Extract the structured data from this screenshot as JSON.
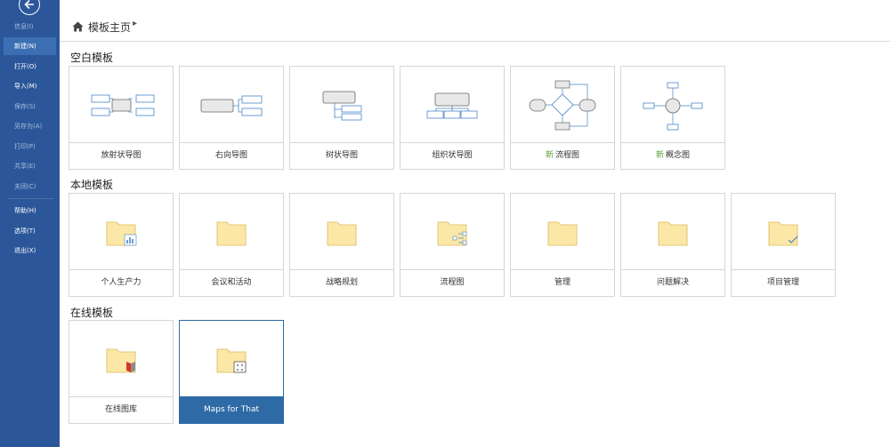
{
  "sidebar": {
    "items": [
      {
        "label": "信息(I)",
        "state": "dim"
      },
      {
        "label": "新建(N)",
        "state": "active"
      },
      {
        "label": "打开(O)",
        "state": "normal"
      },
      {
        "label": "导入(M)",
        "state": "normal"
      },
      {
        "label": "保存(S)",
        "state": "dim"
      },
      {
        "label": "另存为(A)",
        "state": "dim"
      },
      {
        "label": "打印(P)",
        "state": "dim"
      },
      {
        "label": "共享(E)",
        "state": "dim"
      },
      {
        "label": "关闭(C)",
        "state": "dim"
      },
      {
        "label": "帮助(H)",
        "state": "normal"
      },
      {
        "label": "选项(T)",
        "state": "normal"
      },
      {
        "label": "退出(X)",
        "state": "normal"
      }
    ]
  },
  "breadcrumb": {
    "label": "模板主页",
    "chevron": "▸"
  },
  "sections": {
    "blank": {
      "title": "空白模板",
      "items": [
        {
          "label": "放射状导图",
          "thumb": "radial-map"
        },
        {
          "label": "右向导图",
          "thumb": "right-map"
        },
        {
          "label": "树状导图",
          "thumb": "tree-map"
        },
        {
          "label": "组织状导图",
          "thumb": "org-map"
        },
        {
          "label": "流程图",
          "badge": "新",
          "thumb": "flowchart"
        },
        {
          "label": "概念图",
          "badge": "新",
          "thumb": "concept-map"
        }
      ]
    },
    "local": {
      "title": "本地模板",
      "items": [
        {
          "label": "个人生产力",
          "icon": "chart-folder-icon"
        },
        {
          "label": "会议和活动",
          "icon": "folder-icon"
        },
        {
          "label": "战略规划",
          "icon": "folder-icon"
        },
        {
          "label": "流程图",
          "icon": "flow-folder-icon"
        },
        {
          "label": "管理",
          "icon": "folder-icon"
        },
        {
          "label": "问题解决",
          "icon": "folder-icon"
        },
        {
          "label": "项目管理",
          "icon": "check-folder-icon"
        }
      ]
    },
    "online": {
      "title": "在线模板",
      "items": [
        {
          "label": "在线图库",
          "icon": "book-folder-icon"
        },
        {
          "label": "Maps for That",
          "icon": "map-folder-icon",
          "selected": true
        }
      ]
    }
  },
  "colors": {
    "sidebar": "#2b579a",
    "sidebar_active": "#3c6eb3",
    "selected_tile": "#2e6aa6",
    "badge_new": "#5aa03a",
    "folder": "#fce8a6",
    "node_stroke": "#4a86c8"
  }
}
